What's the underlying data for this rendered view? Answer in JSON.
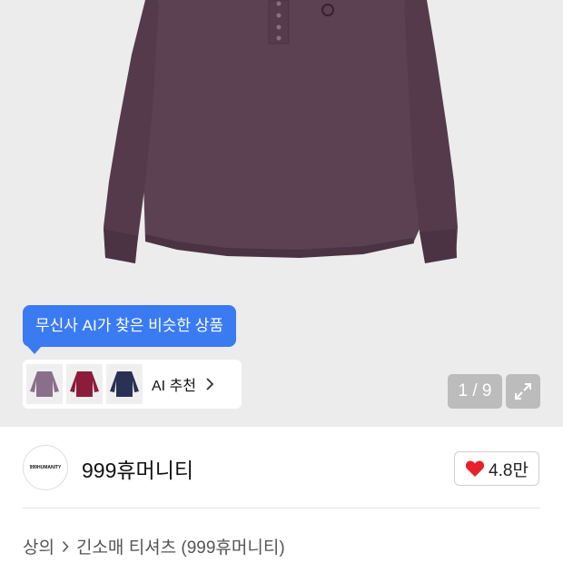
{
  "product_image": {
    "alt_icon": "long-sleeve-henley-shirt",
    "colors": {
      "shirt": "#5c4152",
      "shirt_dark": "#4b3343",
      "background": "#ececec"
    }
  },
  "ai_tooltip": {
    "text": "무신사 AI가 찾은 비슷한 상품",
    "color": "#3a7bf2"
  },
  "ai_recommend": {
    "thumbnails": [
      {
        "icon": "purple-sweater-thumb",
        "color": "#8a6f8b"
      },
      {
        "icon": "burgundy-sweater-thumb",
        "color": "#8b1d3a"
      },
      {
        "icon": "navy-sweater-thumb",
        "color": "#2a3154"
      }
    ],
    "label": "AI 추천",
    "chevron_icon": "chevron-right-icon"
  },
  "gallery": {
    "counter": "1 / 9",
    "expand_icon": "expand-icon"
  },
  "brand": {
    "logo_text": "999HUMANITY",
    "name": "999휴머니티"
  },
  "like": {
    "icon": "heart-icon",
    "count": "4.8만",
    "color": "#e8212b"
  },
  "breadcrumb": {
    "category": "상의",
    "subcategory": "긴소매 티셔츠 (999휴머니티)",
    "separator_icon": "chevron-right-icon"
  }
}
